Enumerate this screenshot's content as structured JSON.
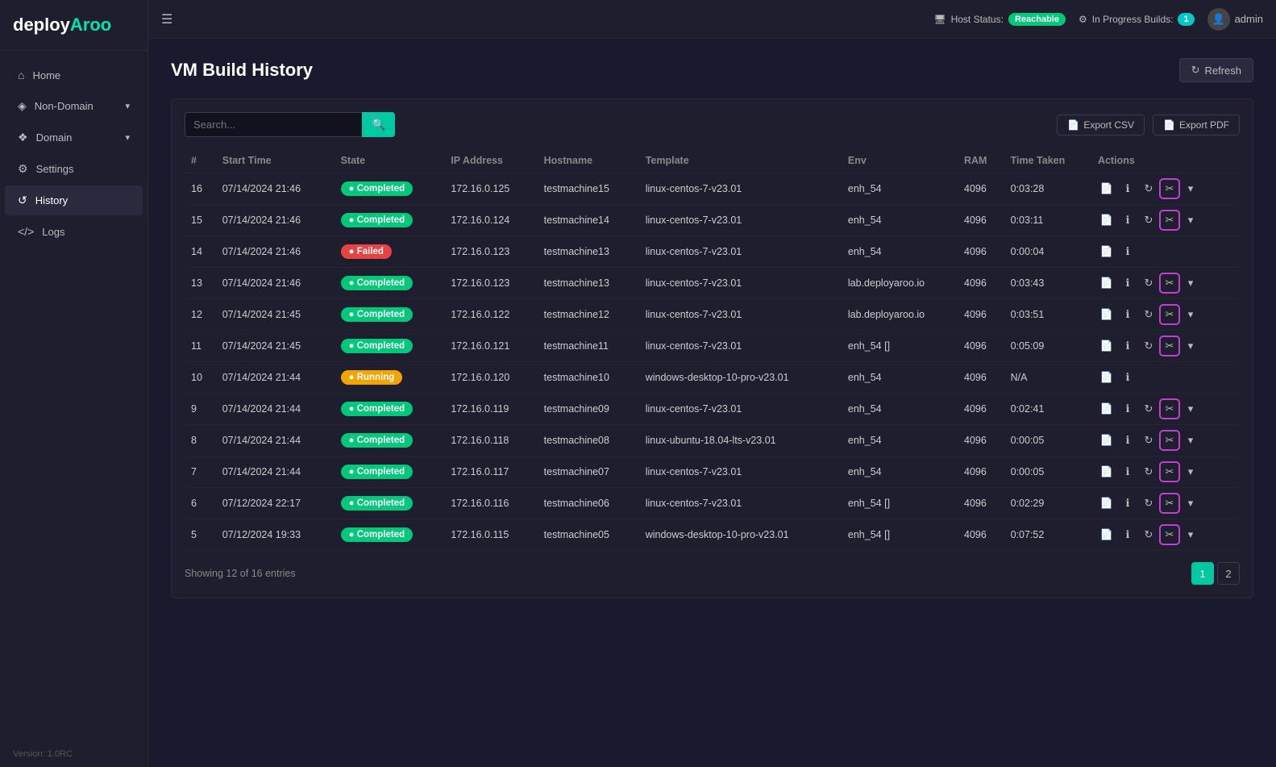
{
  "app": {
    "logo": "deployAroo",
    "version": "Version: 1.0RC"
  },
  "topbar": {
    "menu_icon": "☰",
    "host_status_label": "Host Status:",
    "host_status_value": "Reachable",
    "in_progress_label": "In Progress Builds:",
    "in_progress_count": "1",
    "user": "admin",
    "refresh_label": "Refresh"
  },
  "sidebar": {
    "items": [
      {
        "id": "home",
        "icon": "⌂",
        "label": "Home",
        "active": false
      },
      {
        "id": "non-domain",
        "icon": "◈",
        "label": "Non-Domain",
        "has_chevron": true,
        "active": false
      },
      {
        "id": "domain",
        "icon": "❖",
        "label": "Domain",
        "has_chevron": true,
        "active": false
      },
      {
        "id": "settings",
        "icon": "⚙",
        "label": "Settings",
        "active": false
      },
      {
        "id": "history",
        "icon": "↺",
        "label": "History",
        "active": true
      },
      {
        "id": "logs",
        "icon": "</>",
        "label": "Logs",
        "active": false
      }
    ]
  },
  "page": {
    "title": "VM Build History",
    "refresh_label": "Refresh"
  },
  "toolbar": {
    "search_placeholder": "Search...",
    "search_icon": "🔍",
    "export_csv": "Export CSV",
    "export_pdf": "Export PDF"
  },
  "table": {
    "columns": [
      "#",
      "Start Time",
      "State",
      "IP Address",
      "Hostname",
      "Template",
      "Env",
      "RAM",
      "Time Taken",
      "Actions"
    ],
    "rows": [
      {
        "id": 16,
        "start_time": "07/14/2024 21:46",
        "state": "Completed",
        "ip": "172.16.0.125",
        "hostname": "testmachine15",
        "template": "linux-centos-7-v23.01",
        "env": "enh_54",
        "ram": 4096,
        "time_taken": "0:03:28",
        "highlighted": true
      },
      {
        "id": 15,
        "start_time": "07/14/2024 21:46",
        "state": "Completed",
        "ip": "172.16.0.124",
        "hostname": "testmachine14",
        "template": "linux-centos-7-v23.01",
        "env": "enh_54",
        "ram": 4096,
        "time_taken": "0:03:11",
        "highlighted": true
      },
      {
        "id": 14,
        "start_time": "07/14/2024 21:46",
        "state": "Failed",
        "ip": "172.16.0.123",
        "hostname": "testmachine13",
        "template": "linux-centos-7-v23.01",
        "env": "enh_54",
        "ram": 4096,
        "time_taken": "0:00:04",
        "highlighted": false
      },
      {
        "id": 13,
        "start_time": "07/14/2024 21:46",
        "state": "Completed",
        "ip": "172.16.0.123",
        "hostname": "testmachine13",
        "template": "linux-centos-7-v23.01",
        "env": "lab.deployaroo.io",
        "ram": 4096,
        "time_taken": "0:03:43",
        "highlighted": true
      },
      {
        "id": 12,
        "start_time": "07/14/2024 21:45",
        "state": "Completed",
        "ip": "172.16.0.122",
        "hostname": "testmachine12",
        "template": "linux-centos-7-v23.01",
        "env": "lab.deployaroo.io",
        "ram": 4096,
        "time_taken": "0:03:51",
        "highlighted": true
      },
      {
        "id": 11,
        "start_time": "07/14/2024 21:45",
        "state": "Completed",
        "ip": "172.16.0.121",
        "hostname": "testmachine11",
        "template": "linux-centos-7-v23.01",
        "env": "enh_54 []",
        "ram": 4096,
        "time_taken": "0:05:09",
        "highlighted": true
      },
      {
        "id": 10,
        "start_time": "07/14/2024 21:44",
        "state": "Running",
        "ip": "172.16.0.120",
        "hostname": "testmachine10",
        "template": "windows-desktop-10-pro-v23.01",
        "env": "enh_54",
        "ram": 4096,
        "time_taken": "N/A",
        "highlighted": false
      },
      {
        "id": 9,
        "start_time": "07/14/2024 21:44",
        "state": "Completed",
        "ip": "172.16.0.119",
        "hostname": "testmachine09",
        "template": "linux-centos-7-v23.01",
        "env": "enh_54",
        "ram": 4096,
        "time_taken": "0:02:41",
        "highlighted": true
      },
      {
        "id": 8,
        "start_time": "07/14/2024 21:44",
        "state": "Completed",
        "ip": "172.16.0.118",
        "hostname": "testmachine08",
        "template": "linux-ubuntu-18.04-lts-v23.01",
        "env": "enh_54",
        "ram": 4096,
        "time_taken": "0:00:05",
        "highlighted": true
      },
      {
        "id": 7,
        "start_time": "07/14/2024 21:44",
        "state": "Completed",
        "ip": "172.16.0.117",
        "hostname": "testmachine07",
        "template": "linux-centos-7-v23.01",
        "env": "enh_54",
        "ram": 4096,
        "time_taken": "0:00:05",
        "highlighted": true
      },
      {
        "id": 6,
        "start_time": "07/12/2024 22:17",
        "state": "Completed",
        "ip": "172.16.0.116",
        "hostname": "testmachine06",
        "template": "linux-centos-7-v23.01",
        "env": "enh_54 []",
        "ram": 4096,
        "time_taken": "0:02:29",
        "highlighted": true
      },
      {
        "id": 5,
        "start_time": "07/12/2024 19:33",
        "state": "Completed",
        "ip": "172.16.0.115",
        "hostname": "testmachine05",
        "template": "windows-desktop-10-pro-v23.01",
        "env": "enh_54 []",
        "ram": 4096,
        "time_taken": "0:07:52",
        "highlighted": true
      }
    ],
    "showing_text": "Showing 12 of 16 entries"
  },
  "pagination": {
    "current_page": 1,
    "total_pages": 2,
    "pages": [
      "1",
      "2"
    ]
  }
}
